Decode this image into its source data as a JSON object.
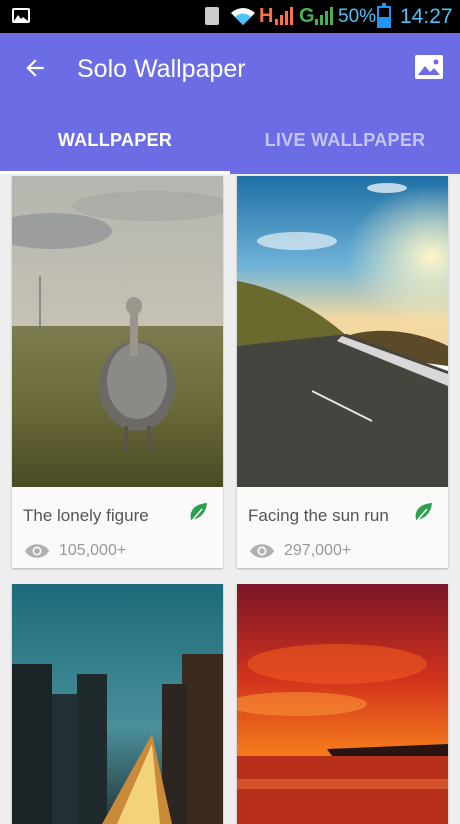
{
  "status_bar": {
    "network1": "H",
    "network2": "G",
    "battery": "50%",
    "time": "14:27"
  },
  "app_bar": {
    "back_icon": "arrow-left",
    "title": "Solo Wallpaper",
    "action_icon": "image",
    "tabs": [
      {
        "label": "WALLPAPER",
        "selected": true
      },
      {
        "label": "LIVE WALLPAPER",
        "selected": false
      }
    ]
  },
  "wallpapers": [
    {
      "title": "The lonely figure",
      "views": "105,000+",
      "icon": "leaf"
    },
    {
      "title": "Facing the sun run",
      "views": "297,000+",
      "icon": "leaf"
    },
    {
      "title": "",
      "views": ""
    },
    {
      "title": "",
      "views": ""
    }
  ],
  "colors": {
    "primary": "#6c6ce5",
    "leaf": "#2e9e4f",
    "status_accent": "#4fc3f7"
  }
}
